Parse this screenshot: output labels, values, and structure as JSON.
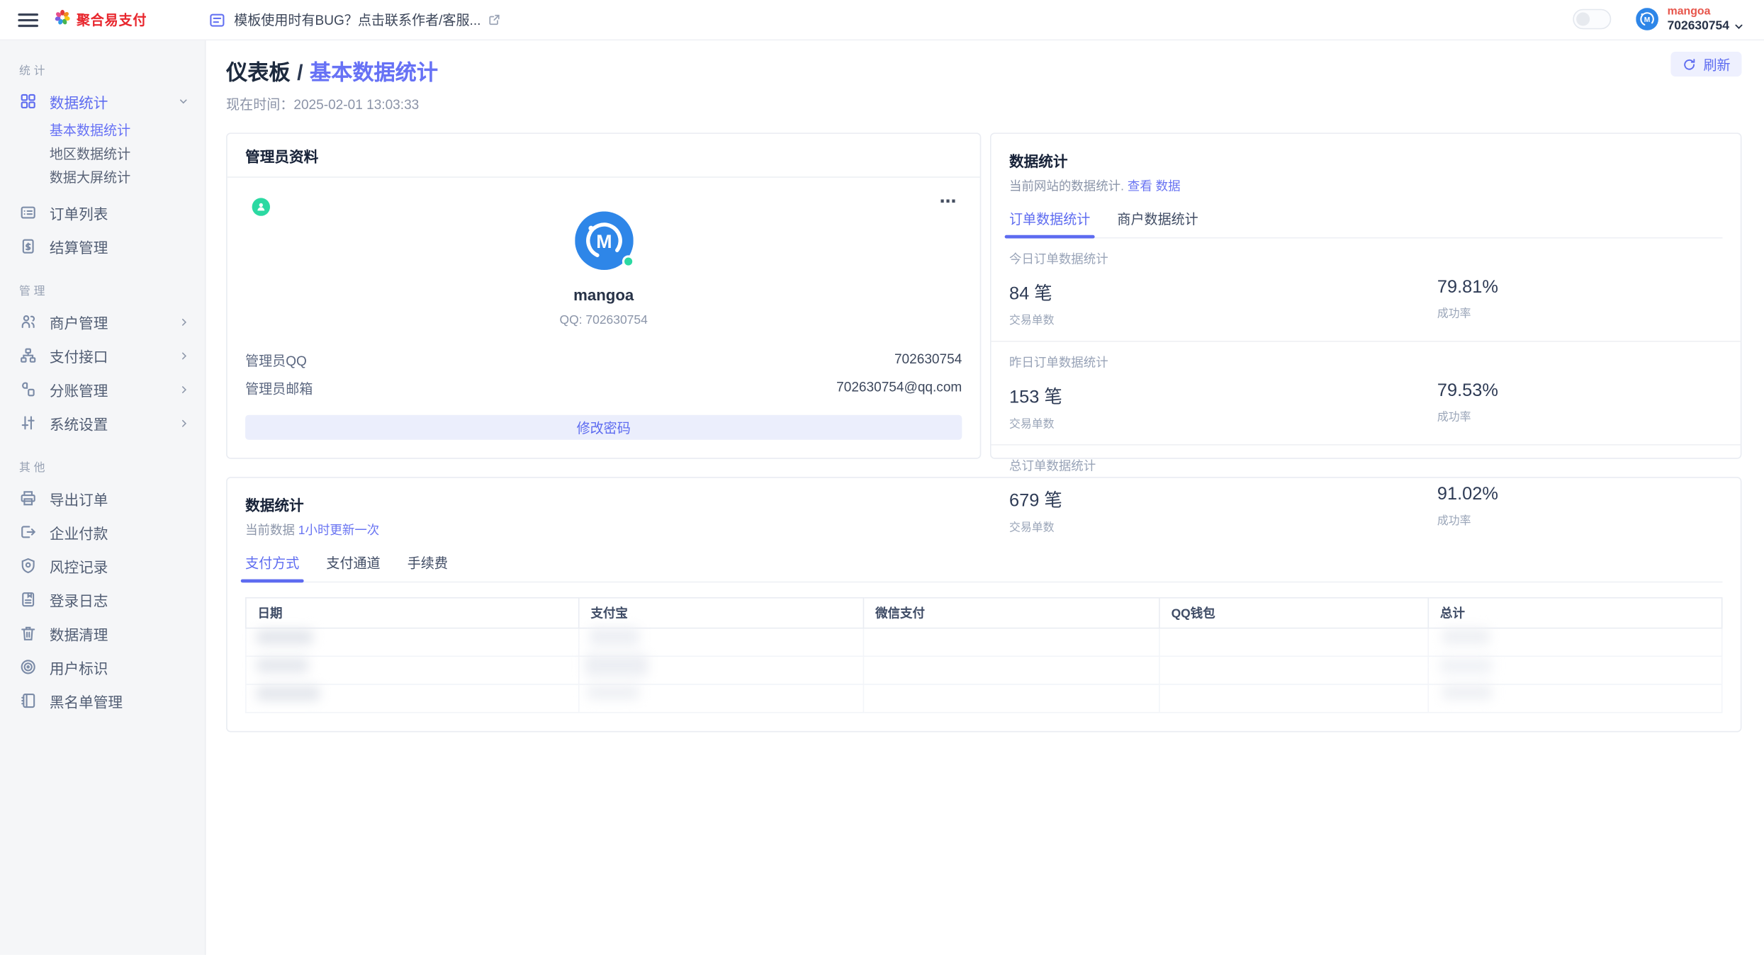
{
  "topbar": {
    "logo_text": "聚合易支付",
    "notice_text": "模板使用时有BUG？点击联系作者/客服...",
    "user": {
      "name": "mangoa",
      "id": "702630754"
    }
  },
  "sidebar": {
    "sections": [
      {
        "label": "统计",
        "items": [
          {
            "label": "数据统计",
            "children": [
              {
                "label": "基本数据统计"
              },
              {
                "label": "地区数据统计"
              },
              {
                "label": "数据大屏统计"
              }
            ]
          },
          {
            "label": "订单列表"
          },
          {
            "label": "结算管理"
          }
        ]
      },
      {
        "label": "管理",
        "items": [
          {
            "label": "商户管理"
          },
          {
            "label": "支付接口"
          },
          {
            "label": "分账管理"
          },
          {
            "label": "系统设置"
          }
        ]
      },
      {
        "label": "其他",
        "items": [
          {
            "label": "导出订单"
          },
          {
            "label": "企业付款"
          },
          {
            "label": "风控记录"
          },
          {
            "label": "登录日志"
          },
          {
            "label": "数据清理"
          },
          {
            "label": "用户标识"
          },
          {
            "label": "黑名单管理"
          }
        ]
      }
    ]
  },
  "page": {
    "breadcrumb_root": "仪表板",
    "breadcrumb_sep": "/",
    "breadcrumb_current": "基本数据统计",
    "time_label": "现在时间：",
    "time_value": "2025-02-01 13:03:33",
    "refresh_label": "刷新"
  },
  "profile_card": {
    "title": "管理员资料",
    "avatar_letter": "M",
    "name": "mangoa",
    "qq_line": "QQ: 702630754",
    "fields": [
      {
        "label": "管理员QQ",
        "value": "702630754"
      },
      {
        "label": "管理员邮箱",
        "value": "702630754@qq.com"
      }
    ],
    "button_label": "修改密码",
    "more_glyph": "⋯"
  },
  "stats_card": {
    "title": "数据统计",
    "subtitle": "当前网站的数据统计.",
    "subtitle_link": "查看 数据",
    "tabs": [
      {
        "label": "订单数据统计"
      },
      {
        "label": "商户数据统计"
      }
    ],
    "sections": [
      {
        "label": "今日订单数据统计",
        "count": "84 笔",
        "count_label": "交易单数",
        "rate": "79.81%",
        "rate_label": "成功率"
      },
      {
        "label": "昨日订单数据统计",
        "count": "153 笔",
        "count_label": "交易单数",
        "rate": "79.53%",
        "rate_label": "成功率"
      },
      {
        "label": "总订单数据统计",
        "count": "679 笔",
        "count_label": "交易单数",
        "rate": "91.02%",
        "rate_label": "成功率"
      }
    ]
  },
  "data_card": {
    "title": "数据统计",
    "subtitle": "当前数据",
    "subtitle_link": "1小时更新一次",
    "tabs": [
      {
        "label": "支付方式"
      },
      {
        "label": "支付通道"
      },
      {
        "label": "手续费"
      }
    ],
    "table": {
      "headers": [
        "日期",
        "支付宝",
        "微信支付",
        "QQ钱包",
        "总计"
      ]
    }
  },
  "colors": {
    "accent": "#5d6bf0",
    "logo_red": "#e8262d",
    "avatar_blue": "#2e86e8",
    "status_green": "#2bd9a2"
  }
}
